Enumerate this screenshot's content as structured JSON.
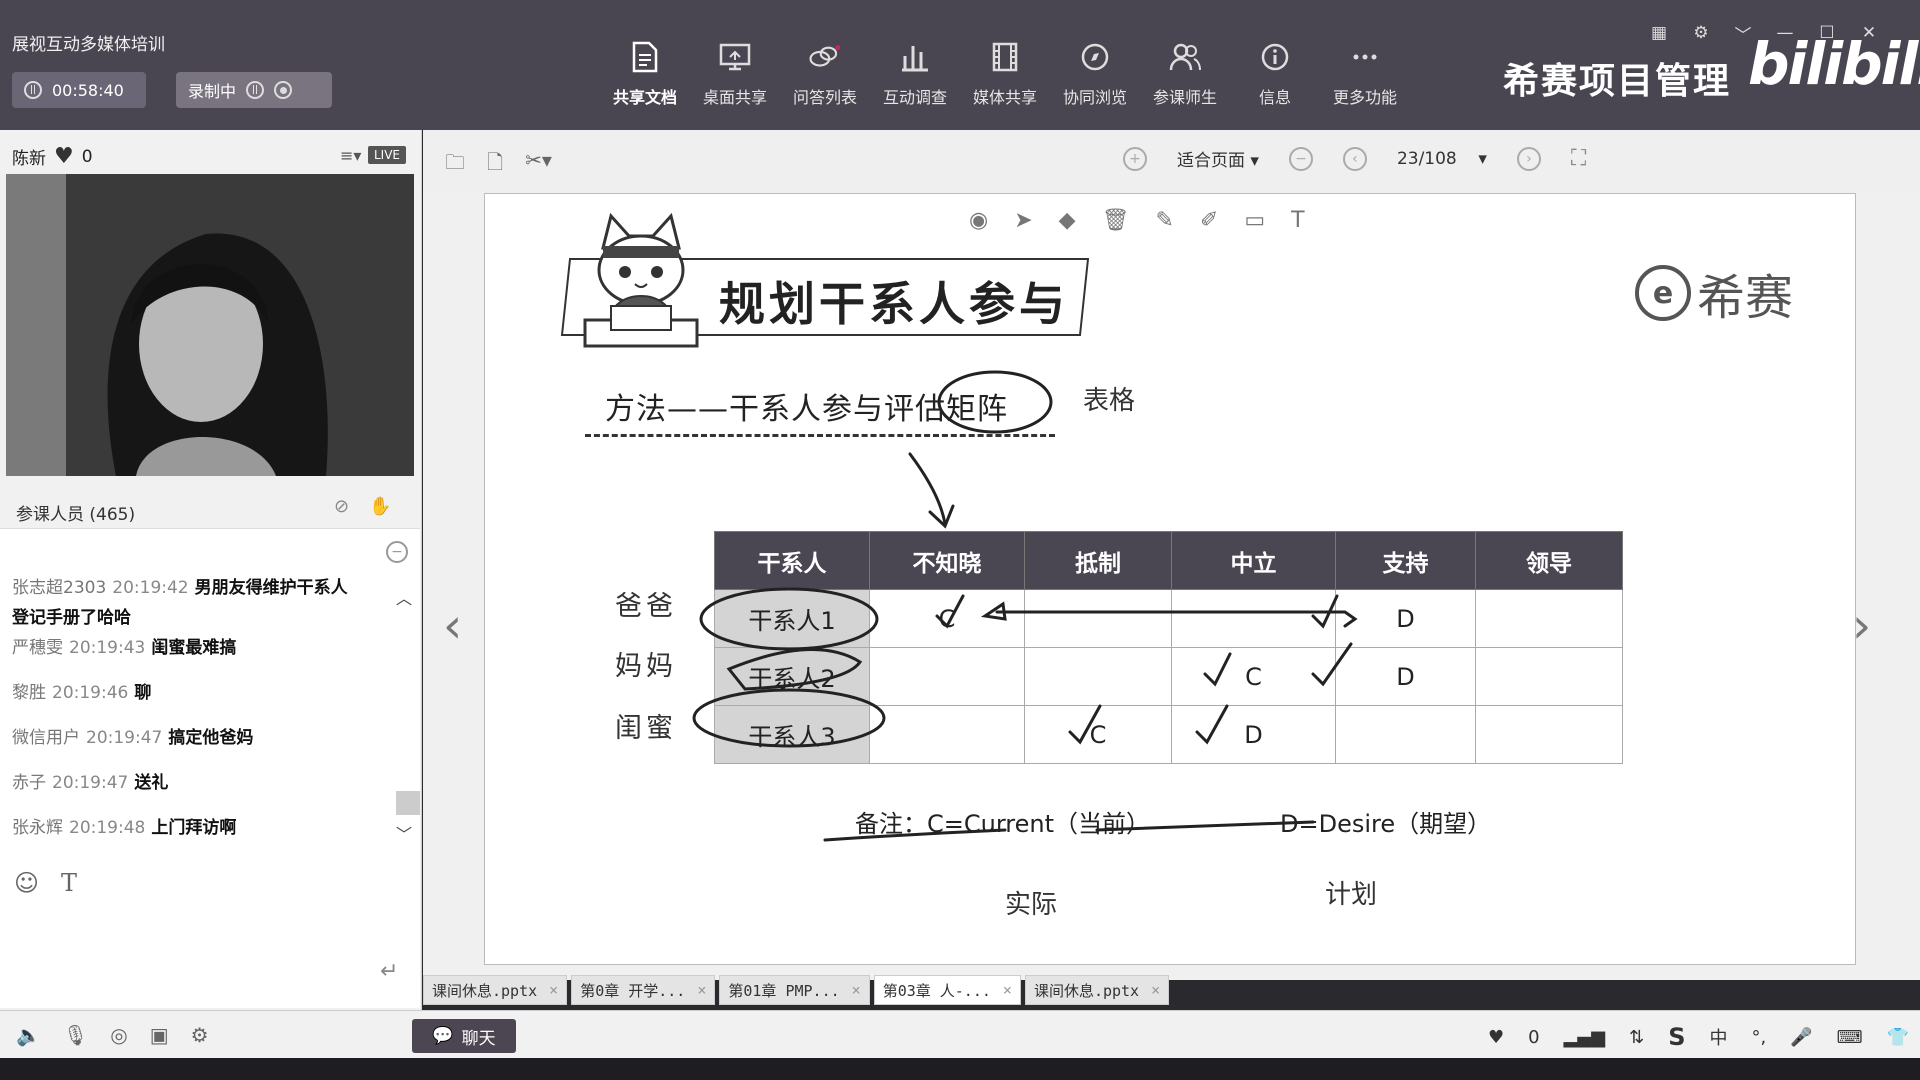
{
  "app": {
    "title": "展视互动多媒体培训",
    "timer": "00:58:40",
    "recording_label": "录制中",
    "brand": "希赛项目管理",
    "bili_logo": "bilibili"
  },
  "toolbar": [
    {
      "label": "共享文档",
      "icon": "document-icon",
      "active": true
    },
    {
      "label": "桌面共享",
      "icon": "desktop-share-icon"
    },
    {
      "label": "问答列表",
      "icon": "qa-bubble-icon"
    },
    {
      "label": "互动调查",
      "icon": "bar-chart-icon"
    },
    {
      "label": "媒体共享",
      "icon": "film-icon"
    },
    {
      "label": "协同浏览",
      "icon": "compass-icon"
    },
    {
      "label": "参课师生",
      "icon": "people-icon"
    },
    {
      "label": "信息",
      "icon": "info-icon"
    },
    {
      "label": "更多功能",
      "icon": "more-icon"
    }
  ],
  "presenter": {
    "name": "陈新",
    "likes": "0",
    "live": "LIVE"
  },
  "attendees": {
    "label": "参课人员 (465)"
  },
  "chat": {
    "messages": [
      {
        "name": "张志超2303",
        "time": "20:19:42",
        "text": "男朋友得维护干系人登记手册了哈哈"
      },
      {
        "name": "严穗雯",
        "time": "20:19:43",
        "text": "闺蜜最难搞"
      },
      {
        "name": "黎胜",
        "time": "20:19:46",
        "text": "聊"
      },
      {
        "name": "微信用户",
        "time": "20:19:47",
        "text": "搞定他爸妈"
      },
      {
        "name": "赤子",
        "time": "20:19:47",
        "text": "送礼"
      },
      {
        "name": "张永辉",
        "time": "20:19:48",
        "text": "上门拜访啊"
      }
    ],
    "button": "聊天"
  },
  "doc_toolbar": {
    "fit": "适合页面",
    "page": "23/108"
  },
  "slide": {
    "title": "规划干系人参与",
    "logo": "希赛",
    "logo_mark": "e",
    "method": "方法——干系人参与评估矩阵",
    "handwritten_note": "表格",
    "matrix": {
      "headers": [
        "干系人",
        "不知晓",
        "抵制",
        "中立",
        "支持",
        "领导"
      ],
      "rows": [
        {
          "side": "爸爸",
          "cells": [
            "干系人1",
            "C",
            "",
            "",
            "D",
            ""
          ]
        },
        {
          "side": "妈妈",
          "cells": [
            "干系人2",
            "",
            "",
            "C",
            "D",
            ""
          ]
        },
        {
          "side": "闺蜜",
          "cells": [
            "干系人3",
            "",
            "C",
            "D",
            "",
            ""
          ]
        }
      ]
    },
    "note_c": "备注：C=Current（当前）",
    "note_d": "D=Desire（期望）",
    "hand_actual": "实际",
    "hand_plan": "计划"
  },
  "tabs": [
    {
      "label": "课间休息.pptx",
      "active": false
    },
    {
      "label": "第0章 开学...",
      "active": false
    },
    {
      "label": "第01章 PMP...",
      "active": false
    },
    {
      "label": "第03章 人-...",
      "active": true
    },
    {
      "label": "课间休息.pptx",
      "active": false
    }
  ],
  "status": {
    "likes": "0",
    "ime": "中"
  }
}
